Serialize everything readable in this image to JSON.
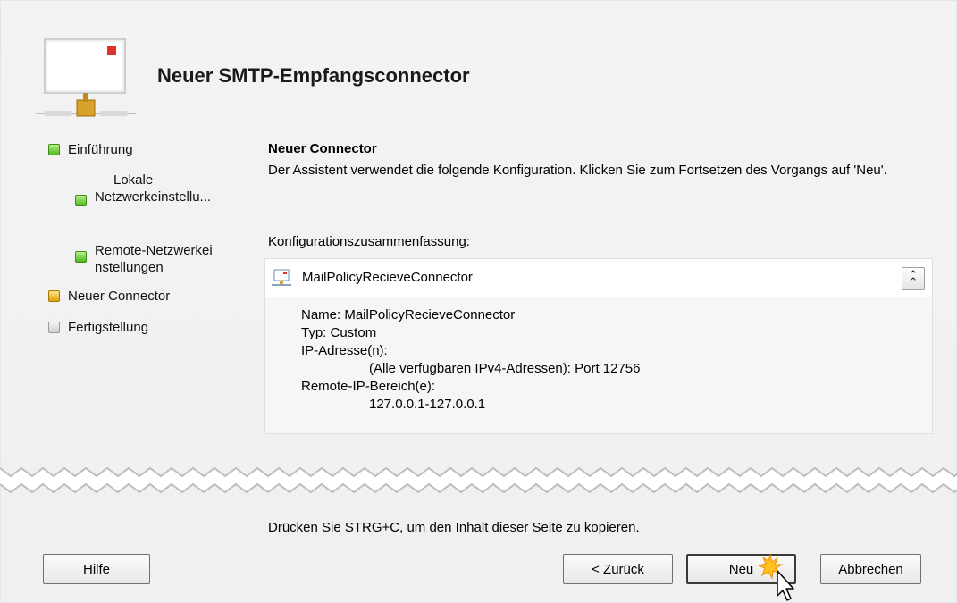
{
  "wizard": {
    "title": "Neuer SMTP-Empfangsconnector"
  },
  "steps": [
    {
      "label": "Einführung",
      "status": "green"
    },
    {
      "label": "Lokale Netzwerkeinstellu...",
      "status": "green"
    },
    {
      "label": "Remote-Netzwerkei nstellungen",
      "status": "green"
    },
    {
      "label": "Neuer Connector",
      "status": "yellow"
    },
    {
      "label": "Fertigstellung",
      "status": "grey"
    }
  ],
  "main": {
    "heading": "Neuer Connector",
    "description": "Der Assistent verwendet die folgende Konfiguration. Klicken Sie zum Fortsetzen des Vorgangs auf 'Neu'.",
    "summary_label": "Konfigurationszusammenfassung:",
    "summary": {
      "connector_name": "MailPolicyRecieveConnector",
      "collapse_glyph": "˄",
      "lines": {
        "name": "Name: MailPolicyRecieveConnector",
        "type": "Typ: Custom",
        "ip_label": "IP-Adresse(n):",
        "ip_value": "(Alle verfügbaren IPv4-Adressen): Port 12756",
        "remote_label": "Remote-IP-Bereich(e):",
        "remote_value": "127.0.0.1-127.0.0.1"
      }
    },
    "copy_hint": "Drücken Sie STRG+C, um den Inhalt dieser Seite zu kopieren."
  },
  "buttons": {
    "help": "Hilfe",
    "back": "< Zurück",
    "new": "Neu",
    "cancel": "Abbrechen"
  },
  "colors": {
    "step_complete": "#4fb81c",
    "step_current": "#e0a10c",
    "step_pending": "#cfcfcf"
  }
}
